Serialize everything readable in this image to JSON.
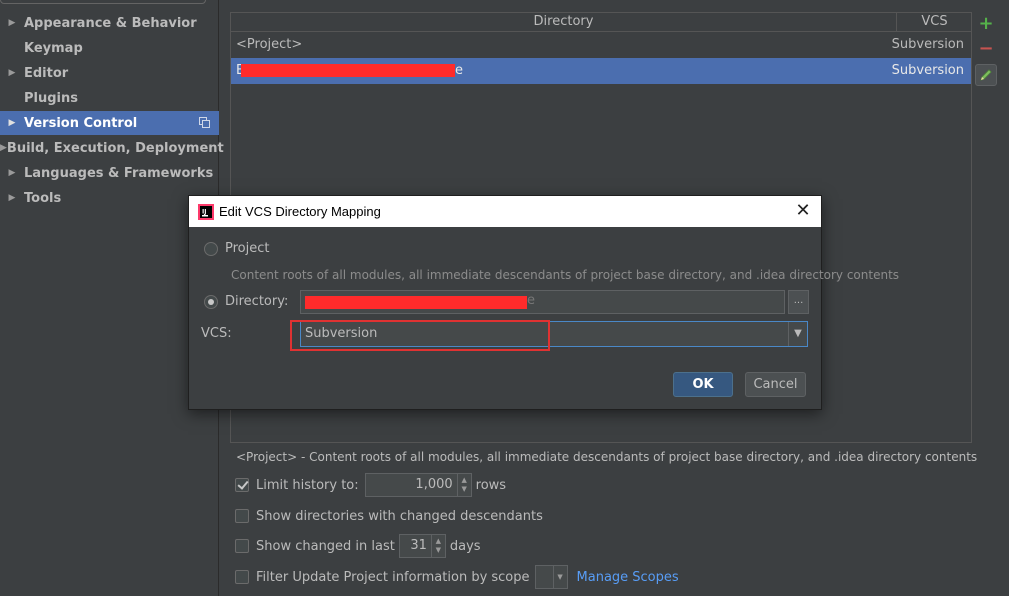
{
  "sidebar": {
    "items": [
      {
        "label": "Appearance & Behavior",
        "expandable": true
      },
      {
        "label": "Keymap",
        "expandable": false
      },
      {
        "label": "Editor",
        "expandable": true
      },
      {
        "label": "Plugins",
        "expandable": false
      },
      {
        "label": "Version Control",
        "expandable": true,
        "selected": true
      },
      {
        "label": "Build, Execution, Deployment",
        "expandable": true
      },
      {
        "label": "Languages & Frameworks",
        "expandable": true
      },
      {
        "label": "Tools",
        "expandable": true
      }
    ]
  },
  "mappings_table": {
    "headers": {
      "directory": "Directory",
      "vcs": "VCS"
    },
    "rows": [
      {
        "directory": "<Project>",
        "vcs": "Subversion",
        "selected": false
      },
      {
        "directory_prefix": "E",
        "directory_suffix": "e",
        "vcs": "Subversion",
        "selected": true
      }
    ]
  },
  "toolbar": {
    "add": "+",
    "remove": "−",
    "edit": "pencil-icon"
  },
  "project_description": "<Project> - Content roots of all modules, all immediate descendants of project base directory, and .idea directory contents",
  "options": {
    "limit_history": {
      "label": "Limit history to:",
      "value": "1,000",
      "suffix": "rows",
      "checked": true
    },
    "show_dirs_changed": {
      "label": "Show directories with changed descendants",
      "checked": false
    },
    "show_changed_last": {
      "label": "Show changed in last",
      "value": "31",
      "suffix": "days",
      "checked": false
    },
    "filter_update": {
      "label": "Filter Update Project information by scope",
      "checked": false
    },
    "manage_scopes_link": "Manage Scopes"
  },
  "dialog": {
    "title": "Edit VCS Directory Mapping",
    "project_option": {
      "label": "Project",
      "selected": false
    },
    "project_hint": "Content roots of all modules, all immediate descendants of project base directory, and .idea directory contents",
    "directory_option": {
      "label": "Directory:",
      "selected": true,
      "value_suffix": "e"
    },
    "browse_label": "...",
    "vcs_label": "VCS:",
    "vcs_value": "Subversion",
    "ok_label": "OK",
    "cancel_label": "Cancel"
  },
  "colors": {
    "background": "#3c3f41",
    "selection": "#4b6eaf",
    "link": "#589df6",
    "redaction": "#ff2b2b",
    "highlight_outline": "#e03232"
  }
}
